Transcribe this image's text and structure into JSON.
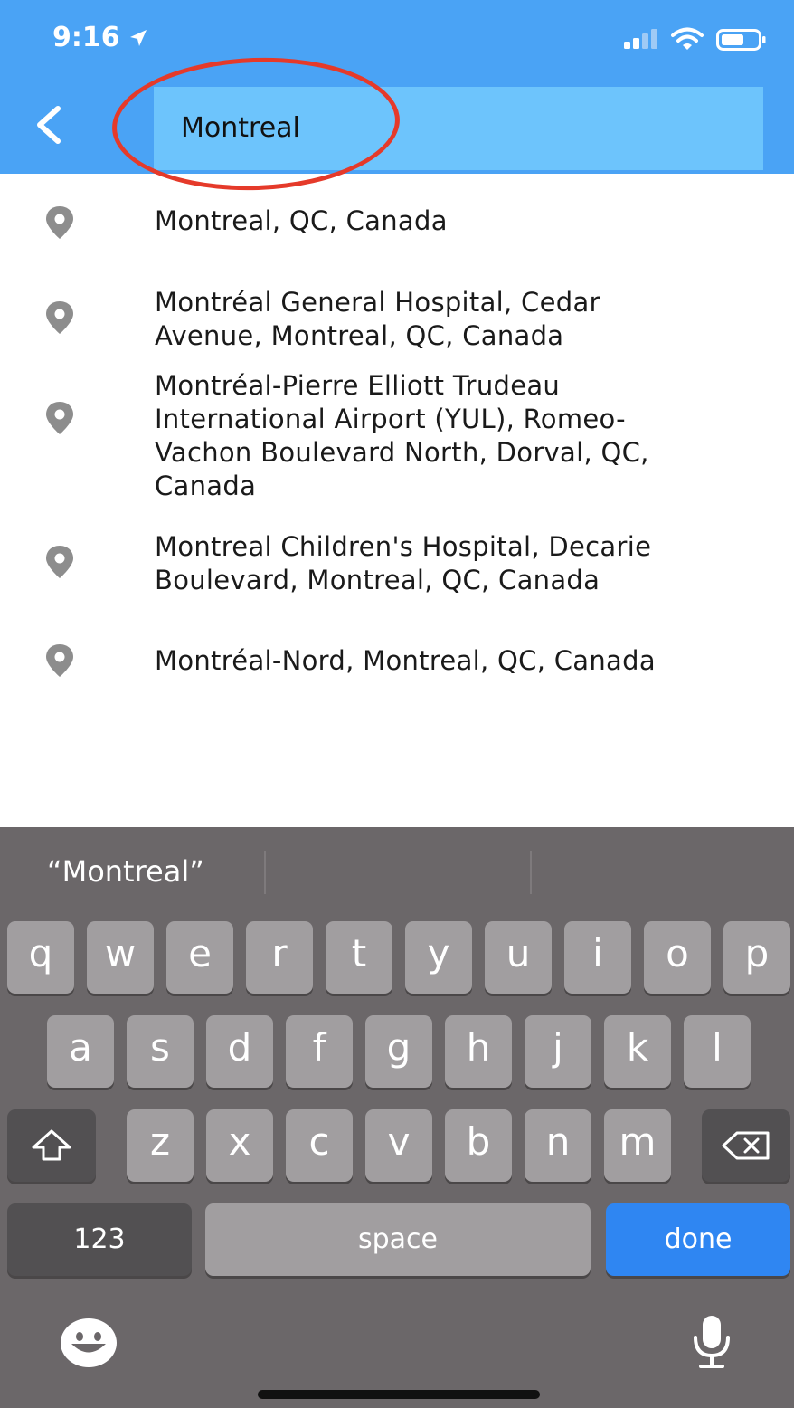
{
  "status_bar": {
    "time": "9:16"
  },
  "search": {
    "value": "Montreal"
  },
  "results": [
    {
      "lines": [
        "Montreal, QC, Canada"
      ]
    },
    {
      "lines": [
        "Montréal General Hospital, Cedar",
        "Avenue, Montreal, QC, Canada"
      ]
    },
    {
      "lines": [
        "Montréal-Pierre Elliott Trudeau",
        "International Airport (YUL), Romeo-",
        "Vachon Boulevard North, Dorval, QC,",
        "Canada"
      ]
    },
    {
      "lines": [
        "Montreal Children's Hospital, Decarie",
        "Boulevard, Montreal, QC, Canada"
      ]
    },
    {
      "lines": [
        "Montréal-Nord, Montreal, QC, Canada"
      ]
    }
  ],
  "keyboard": {
    "suggestion": "“Montreal”",
    "row1": [
      "q",
      "w",
      "e",
      "r",
      "t",
      "y",
      "u",
      "i",
      "o",
      "p"
    ],
    "row2": [
      "a",
      "s",
      "d",
      "f",
      "g",
      "h",
      "j",
      "k",
      "l"
    ],
    "row3": [
      "z",
      "x",
      "c",
      "v",
      "b",
      "n",
      "m"
    ],
    "numbers_label": "123",
    "space_label": "space",
    "done_label": "done"
  },
  "colors": {
    "header": "#4aa3f5",
    "search_field": "#6dc4fc",
    "highlight_ring": "#e53a2a",
    "done_key": "#2f86f2"
  },
  "icons": [
    "back-chevron-icon",
    "location-arrow-icon",
    "cellular-signal-icon",
    "wifi-icon",
    "battery-icon",
    "map-pin-icon",
    "shift-icon",
    "backspace-icon",
    "emoji-icon",
    "microphone-icon"
  ]
}
